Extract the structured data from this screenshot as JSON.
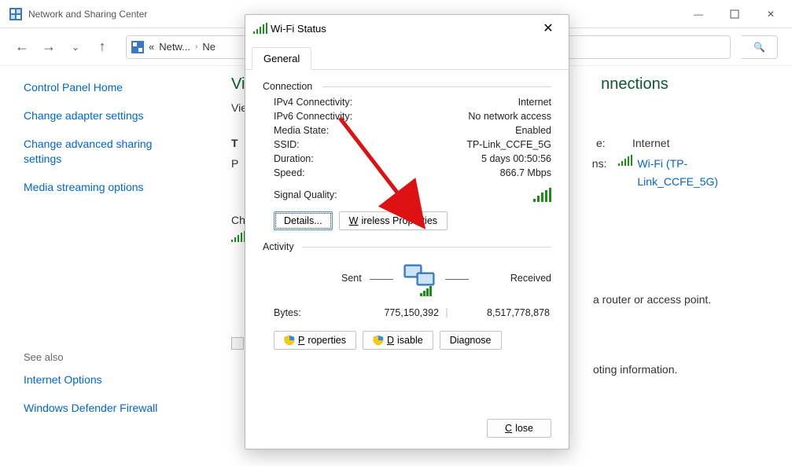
{
  "window": {
    "title": "Network and Sharing Center",
    "breadcrumb": {
      "item1": "Netw...",
      "item2": "Ne"
    }
  },
  "sidebar": {
    "items": [
      "Control Panel Home",
      "Change adapter settings",
      "Change advanced sharing settings",
      "Media streaming options"
    ],
    "see_also_heading": "See also",
    "see_also": [
      "Internet Options",
      "Windows Defender Firewall"
    ]
  },
  "content": {
    "page_title_fragment": "View",
    "page_title_suffix": "nnections",
    "subtitle_fragment": "View",
    "row1": {
      "label_fragment": "T",
      "key": "e:",
      "value": "Internet"
    },
    "row2": {
      "label_fragment": "P",
      "key": "ns:",
      "value": "Wi-Fi (TP-Link_CCFE_5G)"
    },
    "change_heading_fragment": "Chan",
    "text1": "a router or access point.",
    "text2": "oting information."
  },
  "dialog": {
    "title": "Wi-Fi Status",
    "tab": "General",
    "connection_heading": "Connection",
    "activity_heading": "Activity",
    "kv": {
      "ipv4_label": "IPv4 Connectivity:",
      "ipv4_value": "Internet",
      "ipv6_label": "IPv6 Connectivity:",
      "ipv6_value": "No network access",
      "media_label": "Media State:",
      "media_value": "Enabled",
      "ssid_label": "SSID:",
      "ssid_value": "TP-Link_CCFE_5G",
      "duration_label": "Duration:",
      "duration_value": "5 days 00:50:56",
      "speed_label": "Speed:",
      "speed_value": "866.7 Mbps",
      "signal_label": "Signal Quality:"
    },
    "buttons": {
      "details": "Details...",
      "wireless_properties": "Wireless Properties",
      "properties": "Properties",
      "disable": "Disable",
      "diagnose": "Diagnose",
      "close": "Close"
    },
    "activity": {
      "sent_label": "Sent",
      "received_label": "Received",
      "bytes_label": "Bytes:",
      "bytes_sent": "775,150,392",
      "bytes_received": "8,517,778,878"
    }
  }
}
